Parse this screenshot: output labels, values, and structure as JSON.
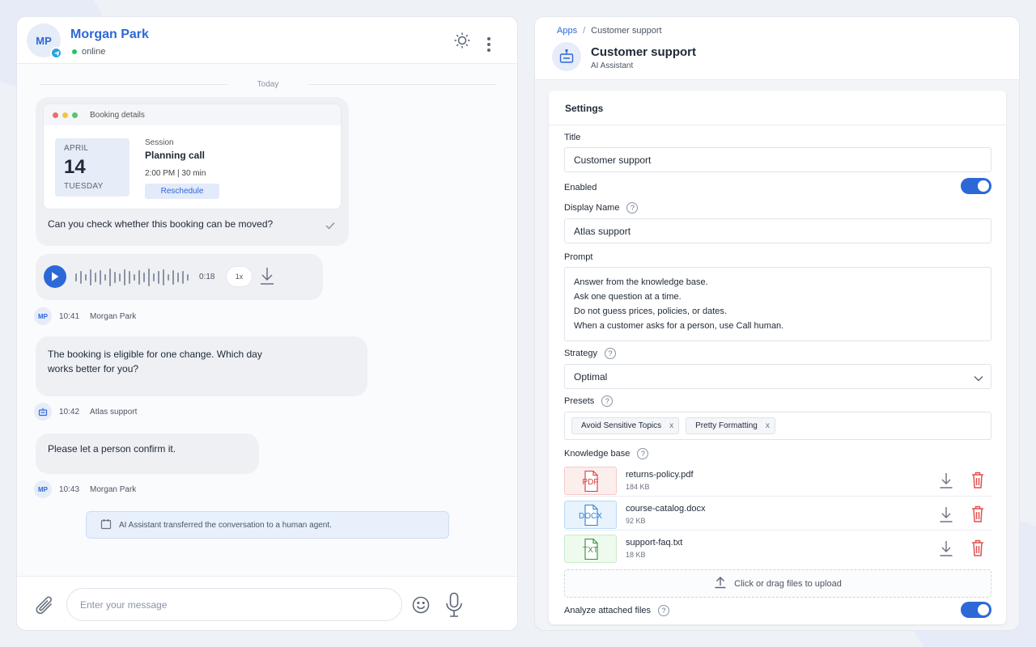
{
  "chat": {
    "contact": {
      "initials": "MP",
      "name": "Morgan Park",
      "status": "online"
    },
    "date_separator": "Today",
    "booking": {
      "card_title": "Booking details",
      "month": "APRIL",
      "day": "14",
      "weekday": "TUESDAY",
      "session_label": "Session",
      "session_title": "Planning call",
      "session_time": "2:00 PM | 30 min",
      "reschedule_label": "Reschedule",
      "message": "Can you check whether this booking can be moved?"
    },
    "audio": {
      "duration": "0:18",
      "speed": "1x"
    },
    "meta1": {
      "initials": "MP",
      "time": "10:41",
      "name": "Morgan Park"
    },
    "msg1": "The booking is eligible for one change. Which day works better for you?",
    "meta2": {
      "time": "10:42",
      "name": "Atlas support"
    },
    "msg2": "Please let a person confirm it.",
    "meta3": {
      "initials": "MP",
      "time": "10:43",
      "name": "Morgan Park"
    },
    "notice": "AI Assistant transferred the conversation to a human agent.",
    "composer": {
      "placeholder": "Enter your message"
    }
  },
  "panel": {
    "breadcrumb": {
      "apps": "Apps",
      "separator": "/",
      "current": "Customer support"
    },
    "title": "Customer support",
    "subtitle": "AI Assistant",
    "settings": {
      "heading": "Settings",
      "title_label": "Title",
      "title_value": "Customer support",
      "enabled_label": "Enabled",
      "enabled": true,
      "display_name_label": "Display Name",
      "display_name_value": "Atlas support",
      "prompt_label": "Prompt",
      "prompt_lines": [
        "Answer from the knowledge base.",
        "Ask one question at a time.",
        "Do not guess prices, policies, or dates.",
        "When a customer asks for a person, use Call human."
      ],
      "strategy_label": "Strategy",
      "strategy_value": "Optimal",
      "presets_label": "Presets",
      "presets": [
        "Avoid Sensitive Topics",
        "Pretty Formatting"
      ],
      "tag_remove": "x",
      "kb_label": "Knowledge base",
      "files": [
        {
          "name": "returns-policy.pdf",
          "size": "184 KB",
          "ext": "PDF",
          "color": "#d63b3b",
          "bg": "#fdeeee",
          "border": "#f5c9c9"
        },
        {
          "name": "course-catalog.docx",
          "size": "92 KB",
          "ext": "DOCX",
          "color": "#2d7fd8",
          "bg": "#e8f3fd",
          "border": "#bcdaf5"
        },
        {
          "name": "support-faq.txt",
          "size": "18 KB",
          "ext": "TXT",
          "color": "#3a8a3a",
          "bg": "#eefaee",
          "border": "#c9ebc9"
        }
      ],
      "upload_label": "Click or drag files to upload",
      "analyze_label": "Analyze attached files",
      "analyze": true
    }
  },
  "colors": {
    "accent": "#2d68d8",
    "online": "#22c55e",
    "delete": "#e05252"
  },
  "icons": [
    "telegram-icon",
    "sun-icon",
    "more-vertical-icon",
    "play-icon",
    "download-icon",
    "check-icon",
    "bot-icon",
    "calendar-icon",
    "paperclip-icon",
    "emoji-icon",
    "microphone-icon",
    "chevron-down-icon",
    "trash-icon",
    "upload-icon",
    "help-icon",
    "file-icon"
  ]
}
